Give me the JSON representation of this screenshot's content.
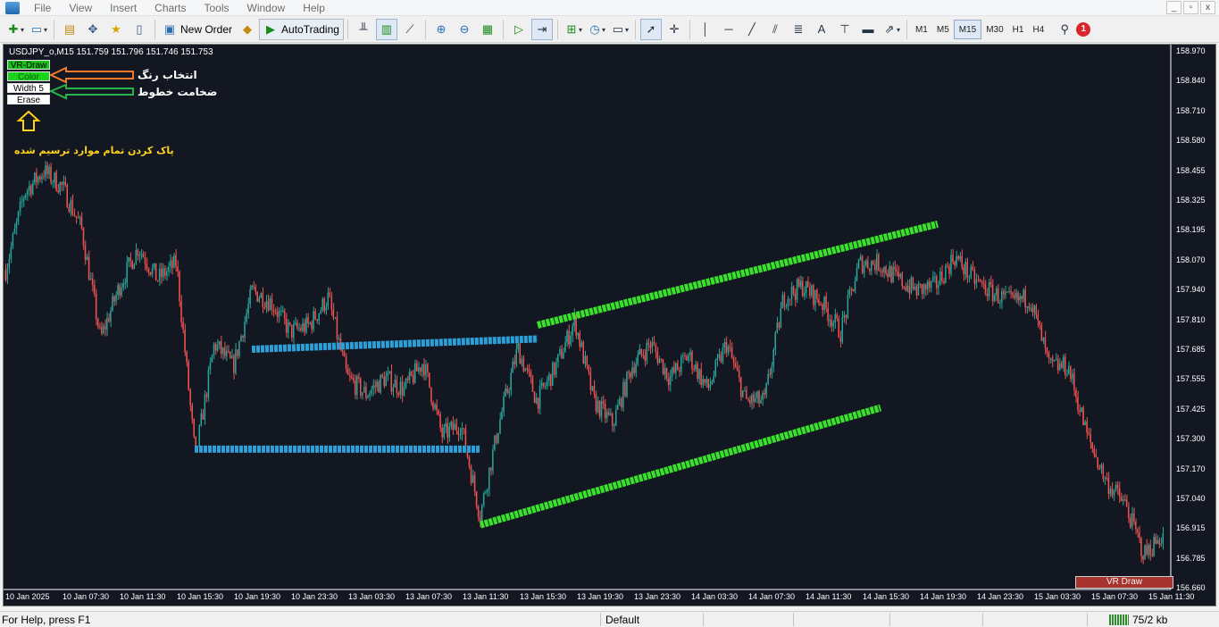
{
  "menu": {
    "items": [
      "File",
      "View",
      "Insert",
      "Charts",
      "Tools",
      "Window",
      "Help"
    ]
  },
  "window_controls": [
    "_",
    "▫",
    "x"
  ],
  "toolbar": {
    "new_order": "New Order",
    "auto_trading": "AutoTrading",
    "timeframes": [
      "M1",
      "M5",
      "M15",
      "M30",
      "H1",
      "H4"
    ],
    "active_timeframe": "M15",
    "notification_count": "1"
  },
  "chart": {
    "symbol_info": "USDJPY_o,M15  151.759 151.796 151.746 151.753",
    "vr_buttons": {
      "draw": "VR-Draw",
      "color": "Color",
      "width": "Width 5",
      "erase": "Erase"
    },
    "annotations": {
      "color_note": "انتخاب رنگ",
      "width_note": "ضخامت خطوط",
      "erase_note": "پاک کردن تمام موارد ترسیم شده"
    },
    "vr_panel_label": "VR Draw",
    "colors": {
      "background": "#131722",
      "bull": "#26a69a",
      "bear": "#ef5350",
      "green_line": "#39e22a",
      "blue_line": "#2ba0d8"
    }
  },
  "chart_data": {
    "type": "candlestick",
    "price_axis_labels": [
      "158.970",
      "158.840",
      "158.710",
      "158.580",
      "158.455",
      "158.325",
      "158.195",
      "158.070",
      "157.940",
      "157.810",
      "157.685",
      "157.555",
      "157.425",
      "157.300",
      "157.170",
      "157.040",
      "156.915",
      "156.785",
      "156.660"
    ],
    "time_axis_labels": [
      "10 Jan 2025",
      "10 Jan 07:30",
      "10 Jan 11:30",
      "10 Jan 15:30",
      "10 Jan 19:30",
      "10 Jan 23:30",
      "13 Jan 03:30",
      "13 Jan 07:30",
      "13 Jan 11:30",
      "13 Jan 15:30",
      "13 Jan 19:30",
      "13 Jan 23:30",
      "14 Jan 03:30",
      "14 Jan 07:30",
      "14 Jan 11:30",
      "14 Jan 15:30",
      "14 Jan 19:30",
      "14 Jan 23:30",
      "15 Jan 03:30",
      "15 Jan 07:30",
      "15 Jan 11:30"
    ],
    "ylim": [
      156.66,
      158.97
    ],
    "path_points": [
      [
        0,
        158.02
      ],
      [
        1,
        158.36
      ],
      [
        2,
        158.45
      ],
      [
        3,
        158.38
      ],
      [
        4,
        158.2
      ],
      [
        5,
        157.72
      ],
      [
        6,
        157.95
      ],
      [
        7,
        158.12
      ],
      [
        8,
        157.98
      ],
      [
        9,
        158.05
      ],
      [
        10,
        157.2
      ],
      [
        11,
        157.7
      ],
      [
        12,
        157.6
      ],
      [
        13,
        157.93
      ],
      [
        14,
        157.88
      ],
      [
        15,
        157.75
      ],
      [
        16,
        157.78
      ],
      [
        17,
        157.9
      ],
      [
        18,
        157.55
      ],
      [
        19,
        157.48
      ],
      [
        20,
        157.55
      ],
      [
        21,
        157.5
      ],
      [
        22,
        157.62
      ],
      [
        23,
        157.3
      ],
      [
        24,
        157.35
      ],
      [
        25,
        156.95
      ],
      [
        26,
        157.35
      ],
      [
        27,
        157.68
      ],
      [
        28,
        157.45
      ],
      [
        29,
        157.6
      ],
      [
        30,
        157.8
      ],
      [
        31,
        157.45
      ],
      [
        32,
        157.35
      ],
      [
        33,
        157.6
      ],
      [
        34,
        157.7
      ],
      [
        35,
        157.55
      ],
      [
        36,
        157.65
      ],
      [
        37,
        157.5
      ],
      [
        38,
        157.7
      ],
      [
        39,
        157.45
      ],
      [
        40,
        157.45
      ],
      [
        41,
        157.9
      ],
      [
        42,
        157.95
      ],
      [
        43,
        157.88
      ],
      [
        44,
        157.75
      ],
      [
        45,
        158.05
      ],
      [
        46,
        158.05
      ],
      [
        47,
        157.98
      ],
      [
        48,
        157.93
      ],
      [
        49,
        157.95
      ],
      [
        50,
        158.08
      ],
      [
        51,
        157.98
      ],
      [
        52,
        157.92
      ],
      [
        53,
        157.88
      ],
      [
        54,
        157.9
      ],
      [
        55,
        157.6
      ],
      [
        56,
        157.6
      ],
      [
        57,
        157.3
      ],
      [
        58,
        157.1
      ],
      [
        59,
        157.0
      ],
      [
        60,
        156.78
      ],
      [
        61,
        156.87
      ]
    ],
    "drawn_lines": [
      {
        "color": "blue",
        "start_label": "10 Jan 19:30",
        "end_label": "13 Jan 15:30",
        "y": [
          157.675,
          157.72
        ]
      },
      {
        "color": "blue",
        "start_label": "10 Jan 15:30",
        "end_label": "13 Jan 11:30",
        "y": [
          157.24,
          157.24
        ]
      },
      {
        "color": "green",
        "start_label": "13 Jan 15:30",
        "end_label": "14 Jan 19:30",
        "y": [
          157.78,
          158.22
        ]
      },
      {
        "color": "green",
        "start_label": "13 Jan 11:30",
        "end_label": "14 Jan 15:30",
        "y": [
          156.91,
          157.42
        ]
      }
    ]
  },
  "status": {
    "help": "For Help, press F1",
    "profile": "Default",
    "traffic": "75/2 kb"
  }
}
